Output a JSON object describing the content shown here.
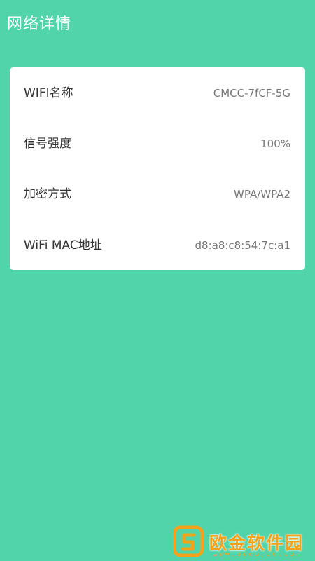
{
  "header": {
    "title": "网络详情"
  },
  "details": {
    "rows": [
      {
        "label": "WIFI名称",
        "value": "CMCC-7fCF-5G"
      },
      {
        "label": "信号强度",
        "value": "100%"
      },
      {
        "label": "加密方式",
        "value": "WPA/WPA2"
      },
      {
        "label": "WiFi MAC地址",
        "value": "d8:a8:c8:54:7c:a1"
      }
    ]
  },
  "watermark": {
    "title": "欧金软件园",
    "url": "www.ououjin.com",
    "color": "#f4a11c"
  },
  "colors": {
    "background": "#52d4ab",
    "card": "#ffffff",
    "label": "#333333",
    "value": "#777777"
  }
}
